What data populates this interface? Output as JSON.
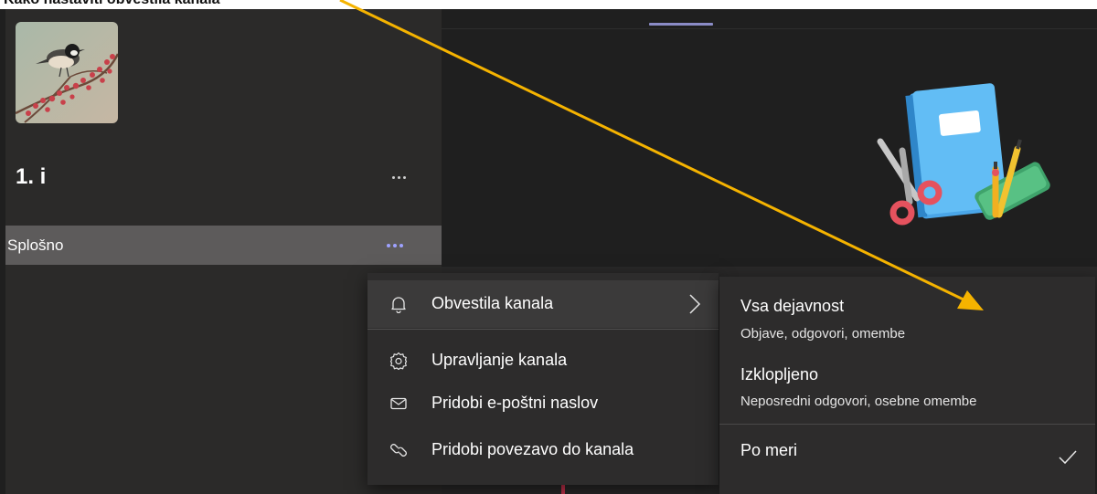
{
  "annotation": {
    "top_text": "Kako nastaviti obvestila kanala",
    "arrow_color": "#f5b300"
  },
  "team": {
    "name": "1. i",
    "avatar_icon": "bird-on-branch-photo",
    "more_icon": "more-horizontal-icon"
  },
  "channel": {
    "label": "Splošno",
    "more_icon": "more-horizontal-icon"
  },
  "channel_menu": {
    "items": [
      {
        "label": "Obvestila kanala",
        "icon": "bell-icon",
        "submenu": true
      },
      {
        "label": "Upravljanje kanala",
        "icon": "gear-icon"
      },
      {
        "label": "Pridobi e-poštni naslov",
        "icon": "envelope-icon"
      },
      {
        "label": "Pridobi povezavo do kanala",
        "icon": "link-icon"
      }
    ]
  },
  "notifications_submenu": {
    "options": [
      {
        "title": "Vsa dejavnost",
        "desc": "Objave, odgovori, omembe"
      },
      {
        "title": "Izklopljeno",
        "desc": "Neposredni odgovori, osebne omembe"
      },
      {
        "title": "Po meri",
        "checked": true
      }
    ]
  },
  "illustration": {
    "icon": "notebook-scissors-pencils-illustration"
  },
  "colors": {
    "left_panel": "#2b2a29",
    "selected_row": "#5d5b5b",
    "right_panel": "#1f1f1f",
    "menu": "#2d2c2c",
    "accent": "#9ea2ff"
  }
}
